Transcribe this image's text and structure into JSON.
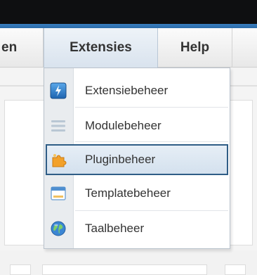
{
  "menubar": {
    "items": [
      {
        "label": "en"
      },
      {
        "label": "Extensies"
      },
      {
        "label": "Help"
      }
    ]
  },
  "dropdown": {
    "items": [
      {
        "label": "Extensiebeheer",
        "icon": "lightning-icon"
      },
      {
        "label": "Modulebeheer",
        "icon": "module-lines-icon"
      },
      {
        "label": "Pluginbeheer",
        "icon": "plugin-puzzle-icon",
        "selected": true
      },
      {
        "label": "Templatebeheer",
        "icon": "template-window-icon"
      },
      {
        "label": "Taalbeheer",
        "icon": "globe-icon"
      }
    ]
  },
  "colors": {
    "topbar": "#0e0f11",
    "accent": "#2f6fb0",
    "selection_border": "#2f5d86"
  }
}
